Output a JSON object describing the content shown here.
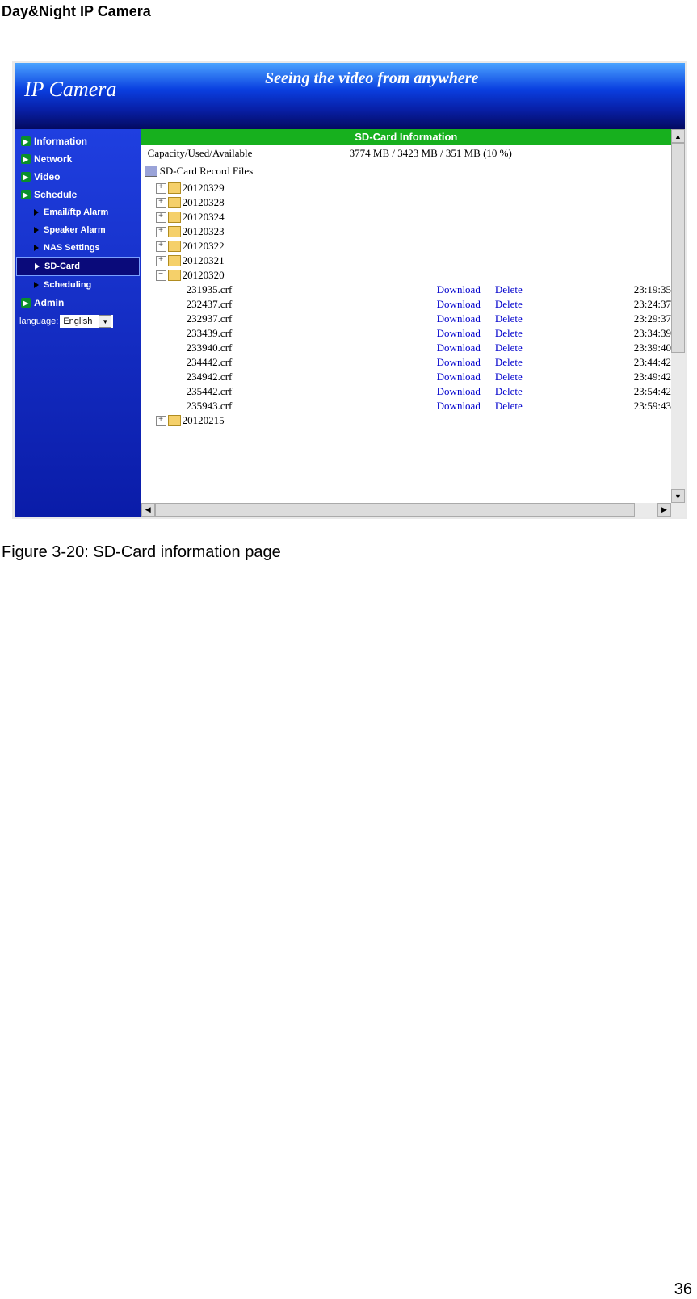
{
  "doc": {
    "title": "Day&Night IP Camera",
    "figure_caption": "Figure 3-20: SD-Card information page",
    "page_number": "36"
  },
  "banner": {
    "brand": "IP Camera",
    "tagline": "Seeing the video from anywhere"
  },
  "sidebar": {
    "items": [
      {
        "label": "Information"
      },
      {
        "label": "Network"
      },
      {
        "label": "Video"
      },
      {
        "label": "Schedule"
      }
    ],
    "sub_items": [
      {
        "label": "Email/ftp Alarm"
      },
      {
        "label": "Speaker Alarm"
      },
      {
        "label": "NAS Settings"
      },
      {
        "label": "SD-Card",
        "selected": true
      },
      {
        "label": "Scheduling"
      }
    ],
    "admin_label": "Admin",
    "language_label": "language:",
    "language_value": "English"
  },
  "panel": {
    "header": "SD-Card Information",
    "capacity_label": "Capacity/Used/Available",
    "capacity_value": "3774 MB / 3423 MB / 351 MB (10 %)",
    "record_title": "SD-Card Record Files",
    "folders_closed": [
      "20120329",
      "20120328",
      "20120324",
      "20120323",
      "20120322",
      "20120321"
    ],
    "folder_open": "20120320",
    "files": [
      {
        "name": "231935.crf",
        "time": "23:19:35"
      },
      {
        "name": "232437.crf",
        "time": "23:24:37"
      },
      {
        "name": "232937.crf",
        "time": "23:29:37"
      },
      {
        "name": "233439.crf",
        "time": "23:34:39"
      },
      {
        "name": "233940.crf",
        "time": "23:39:40"
      },
      {
        "name": "234442.crf",
        "time": "23:44:42"
      },
      {
        "name": "234942.crf",
        "time": "23:49:42"
      },
      {
        "name": "235442.crf",
        "time": "23:54:42"
      },
      {
        "name": "235943.crf",
        "time": "23:59:43"
      }
    ],
    "last_folder": "20120215",
    "download_label": "Download",
    "delete_label": "Delete"
  }
}
